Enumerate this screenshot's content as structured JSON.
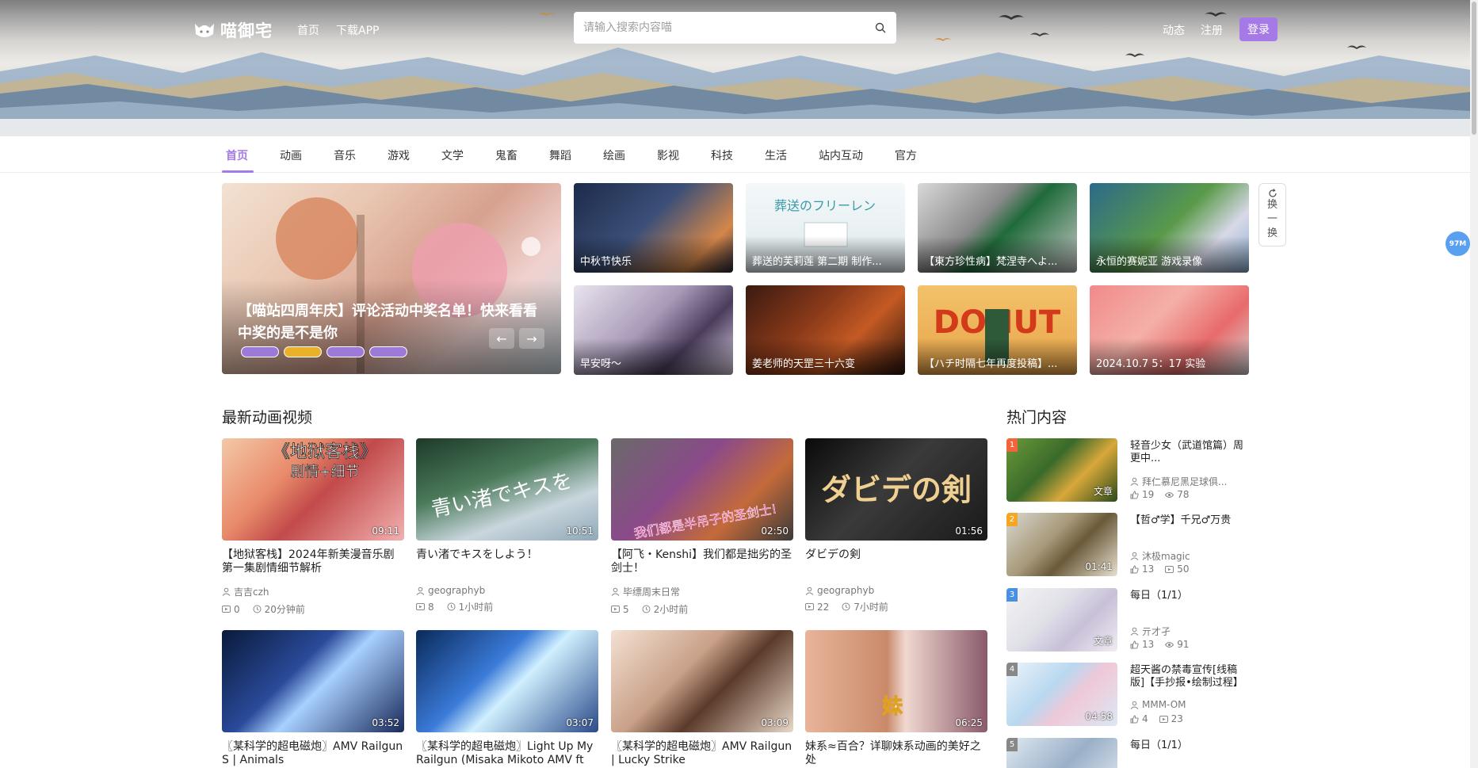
{
  "header": {
    "logo_text": "喵御宅",
    "nav": [
      "首页",
      "下载APP"
    ],
    "search_placeholder": "请输入搜索内容喵",
    "right_links": [
      "动态",
      "注册"
    ],
    "login_label": "登录"
  },
  "category_nav": {
    "active": "首页",
    "items": [
      "首页",
      "动画",
      "音乐",
      "游戏",
      "文学",
      "鬼畜",
      "舞蹈",
      "绘画",
      "影视",
      "科技",
      "生活",
      "站内互动",
      "官方"
    ]
  },
  "carousel": {
    "title": "【喵站四周年庆】评论活动中奖名单！快来看看中奖的是不是你",
    "prev_label": "←",
    "next_label": "→"
  },
  "featured": [
    {
      "caption": "中秋节快乐"
    },
    {
      "caption": "葬送的芙莉莲 第二期 制作..."
    },
    {
      "caption": "【東方珍性病】梵涅寺へよ..."
    },
    {
      "caption": "永恒的赛妮亚 游戏录像"
    },
    {
      "caption": "早安呀～"
    },
    {
      "caption": "姜老师的天罡三十六变"
    },
    {
      "caption": "【ハチ时隔七年再度投稿】..."
    },
    {
      "caption": "2024.10.7 5：17 实验"
    }
  ],
  "swap_label": [
    "换",
    "一",
    "换"
  ],
  "float_badge": "97M",
  "latest_section": {
    "title": "最新动画视频",
    "videos": [
      {
        "title": "【地狱客栈】2024年新美漫音乐剧第一集剧情细节解析",
        "duration": "09:11",
        "author": "吉吉czh",
        "plays": "0",
        "time": "20分钟前"
      },
      {
        "title": "青い渚でキスをしよう！",
        "duration": "10:51",
        "author": "geographyb",
        "plays": "8",
        "time": "1小时前"
      },
      {
        "title": "【阿飞・Kenshi】我们都是拙劣的圣剑士！",
        "duration": "02:50",
        "author": "毕缥周末日常",
        "plays": "5",
        "time": "2小时前"
      },
      {
        "title": "ダビデの剣",
        "duration": "01:56",
        "author": "geographyb",
        "plays": "22",
        "time": "7小时前"
      },
      {
        "title": "〖某科学的超电磁炮〗AMV Railgun S | Animals",
        "duration": "03:52"
      },
      {
        "title": "〖某科学的超电磁炮〗Light Up My Railgun (Misaka Mikoto AMV ft Lig...",
        "duration": "03:07"
      },
      {
        "title": "〖某科学的超电磁炮〗AMV Railgun | Lucky Strike",
        "duration": "03:09"
      },
      {
        "title": "妹系≈百合？详聊妹系动画的美好之处",
        "duration": "06:25"
      }
    ]
  },
  "hot_section": {
    "title": "热门内容",
    "items": [
      {
        "rank": "1",
        "title": "轻音少女（武道馆篇）周更中...",
        "tag": "文章",
        "author": "拜仁慕尼黑足球俱...",
        "likes": "19",
        "views": "78"
      },
      {
        "rank": "2",
        "title": "【哲♂学】千兄♂万贵",
        "tag": "01:41",
        "author": "沐极magic",
        "likes": "13",
        "views": "50"
      },
      {
        "rank": "3",
        "title": "每日（1/1）",
        "tag": "文章",
        "author": "亓才孑",
        "likes": "13",
        "views": "91"
      },
      {
        "rank": "4",
        "title": "超天酱の禁毒宣传[线稿版]【手抄报•绘制过程】",
        "tag": "04:58",
        "author": "MMM-OM",
        "likes": "4",
        "views": "23"
      },
      {
        "rank": "5",
        "title": "每日（1/1）"
      }
    ]
  },
  "colors": {
    "accent": "#a57ae6",
    "rank1": "#f4643c",
    "rank2": "#f5a623",
    "rank3": "#4a90e2",
    "rank4": "#888888",
    "rank5": "#888888"
  }
}
